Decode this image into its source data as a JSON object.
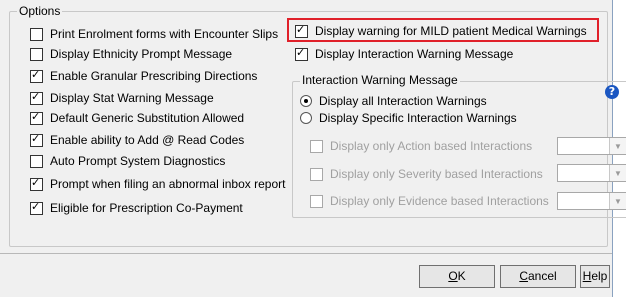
{
  "options": {
    "title": "Options",
    "left_items": [
      {
        "label": "Print Enrolment forms with Encounter Slips",
        "checked": false
      },
      {
        "label": "Display Ethnicity Prompt Message",
        "checked": false
      },
      {
        "label": "Enable Granular Prescribing Directions",
        "checked": true
      },
      {
        "label": "Display Stat Warning Message",
        "checked": true
      },
      {
        "label": "Default Generic Substitution Allowed",
        "checked": true
      },
      {
        "label": "Enable ability to Add @ Read Codes",
        "checked": true
      },
      {
        "label": "Auto Prompt System Diagnostics",
        "checked": false
      },
      {
        "label": "Prompt when filing an abnormal inbox report",
        "checked": true
      },
      {
        "label": "Eligible for Prescription Co-Payment",
        "checked": true
      }
    ],
    "right_items": [
      {
        "label": "Display warning for MILD patient Medical Warnings",
        "checked": true
      },
      {
        "label": "Display Interaction Warning Message",
        "checked": true
      }
    ]
  },
  "interaction": {
    "title": "Interaction Warning Message",
    "radios": [
      {
        "label": "Display all Interaction Warnings",
        "selected": true
      },
      {
        "label": "Display Specific Interaction Warnings",
        "selected": false
      }
    ],
    "filters": [
      {
        "label": "Display only Action based Interactions",
        "checked": false,
        "combo_value": ""
      },
      {
        "label": "Display only Severity based Interactions",
        "checked": false,
        "combo_value": ""
      },
      {
        "label": "Display only Evidence based Interactions",
        "checked": false,
        "combo_value": ""
      }
    ],
    "help_icon": "question-mark-icon",
    "help_glyph": "?"
  },
  "buttons": {
    "ok": {
      "mnemonic": "O",
      "rest": "K"
    },
    "cancel": {
      "mnemonic": "C",
      "rest": "ancel"
    },
    "help": {
      "mnemonic": "H",
      "rest": "elp"
    }
  },
  "colors": {
    "highlight_border": "#e0202a",
    "help_icon_bg": "#1b57c2"
  }
}
